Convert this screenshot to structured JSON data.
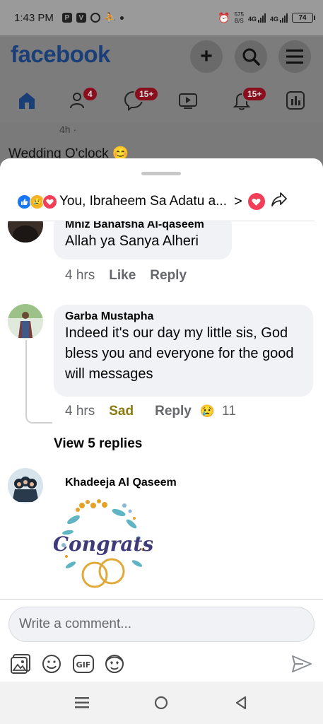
{
  "status_bar": {
    "time": "1:43 PM",
    "left_icons": [
      "P",
      "V",
      "whatsapp-icon",
      "person-add-icon",
      "dot-icon"
    ],
    "speed_value": "575",
    "speed_unit": "B/S",
    "net1": "4G",
    "net2": "4G",
    "battery": "74"
  },
  "fb_header": {
    "logo": "facebook",
    "nav_badges": {
      "friends": "4",
      "messenger": "15+",
      "notifications": "15+"
    }
  },
  "post_peek": {
    "time": "4h ·",
    "text": "Wedding O'clock 😊"
  },
  "reactions_bar": {
    "names": "You, Ibraheem Sa Adatu a...",
    "chevron": ">"
  },
  "comments": [
    {
      "author": "Mniz Banafsha Al-qaseem",
      "text": "Allah ya Sanya Alheri",
      "time": "4 hrs",
      "reaction_label": "Like",
      "reply_label": "Reply"
    },
    {
      "author": "Garba Mustapha",
      "text": "Indeed it's our day my little sis, God bless you and everyone for the good will messages",
      "time": "4 hrs",
      "reaction_label": "Sad",
      "reply_label": "Reply",
      "reaction_count": "11",
      "view_replies": "View 5 replies"
    },
    {
      "author": "Khadeeja Al Qaseem",
      "sticker_text": "Congrats"
    }
  ],
  "composer": {
    "placeholder": "Write a comment..."
  },
  "colors": {
    "fb_blue": "#1877f2",
    "sad_gold": "#8a7b0e",
    "love_red": "#f33e58"
  }
}
